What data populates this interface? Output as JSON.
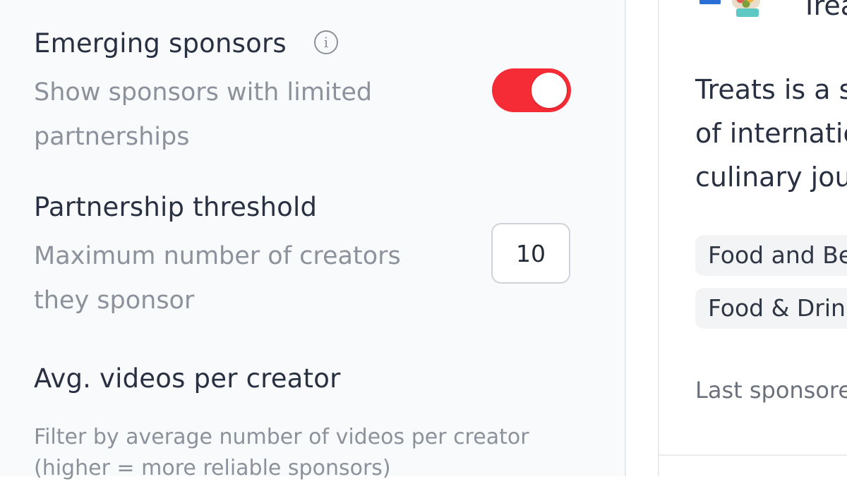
{
  "settings": {
    "emerging": {
      "title": "Emerging sponsors",
      "description_line1": "Show sponsors with limited",
      "description_line2": "partnerships",
      "info_glyph": "i",
      "toggle_on": true,
      "toggle_color": "#f52c36"
    },
    "threshold": {
      "title": "Partnership threshold",
      "description_line1": "Maximum number of creators",
      "description_line2": "they sponsor",
      "value": "10"
    },
    "avg_videos": {
      "title": "Avg. videos per creator",
      "description": "Filter by average number of videos per creator (higher = more reliable sponsors)"
    }
  },
  "sponsor_card": {
    "name": "Treats",
    "description_line1": "Treats is a s",
    "description_line2": "of internatic",
    "description_line3": "culinary jou",
    "tags": [
      "Food and Be",
      "Food & Drin"
    ],
    "last_sponsored_label": "Last sponsore"
  },
  "icons": {
    "info": "info-icon",
    "logo": "treats-logo"
  }
}
